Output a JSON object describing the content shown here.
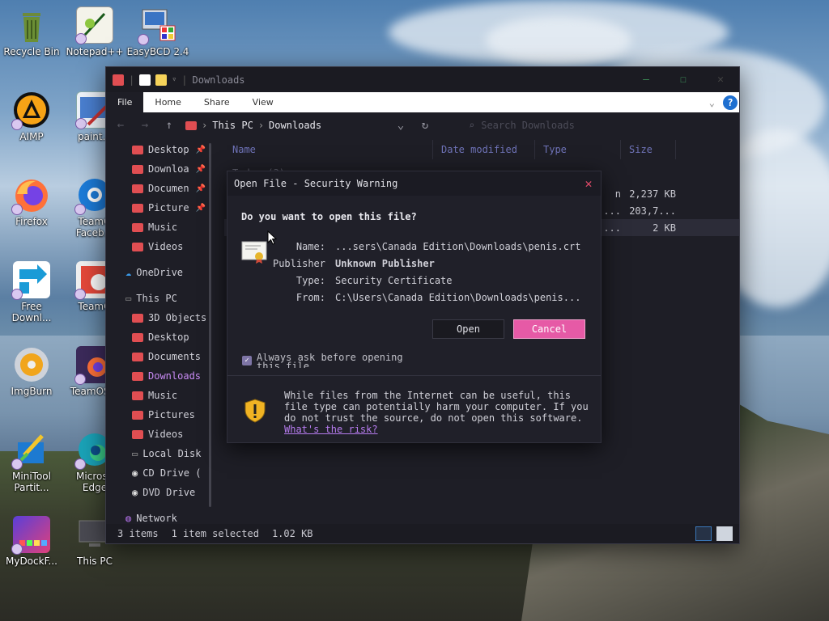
{
  "desktop": {
    "icons": [
      {
        "label": "Recycle Bin",
        "icon": "recycle-bin-icon"
      },
      {
        "label": "Notepad++",
        "icon": "notepad-plus-plus-icon"
      },
      {
        "label": "EasyBCD 2.4",
        "icon": "easybcd-icon"
      },
      {
        "label": "AIMP",
        "icon": "aimp-icon"
      },
      {
        "label": "paint.n",
        "icon": "paint-net-icon"
      },
      {
        "label": "Firefox",
        "icon": "firefox-icon"
      },
      {
        "label": "TeamO Faceb...",
        "icon": "teamos-facebook-icon"
      },
      {
        "label": "Free Downl...",
        "icon": "free-download-manager-icon"
      },
      {
        "label": "TeamO",
        "icon": "teamos-icon"
      },
      {
        "label": "ImgBurn",
        "icon": "imgburn-icon"
      },
      {
        "label": "TeamOS...",
        "icon": "teamos-firefox-icon"
      },
      {
        "label": "MiniTool Partit...",
        "icon": "minitool-partition-icon"
      },
      {
        "label": "Microso Edge",
        "icon": "microsoft-edge-icon"
      },
      {
        "label": "MyDockF...",
        "icon": "mydockfinder-icon"
      },
      {
        "label": "This PC",
        "icon": "this-pc-icon"
      }
    ]
  },
  "explorer": {
    "title": "Downloads",
    "window_buttons": {
      "minimize": "—",
      "maximize": "☐",
      "close": "✕"
    },
    "ribbon_tabs": [
      "File",
      "Home",
      "Share",
      "View"
    ],
    "help": "?",
    "address": {
      "root": "This PC",
      "current": "Downloads",
      "search_placeholder": "Search Downloads"
    },
    "nav": {
      "quick_access": [
        {
          "label": "Desktop",
          "pinned": true
        },
        {
          "label": "Downloa",
          "pinned": true
        },
        {
          "label": "Documen",
          "pinned": true
        },
        {
          "label": "Picture",
          "pinned": true
        },
        {
          "label": "Music",
          "pinned": false
        },
        {
          "label": "Videos",
          "pinned": false
        }
      ],
      "onedrive": "OneDrive",
      "this_pc": "This PC",
      "this_pc_items": [
        "3D Objects",
        "Desktop",
        "Documents",
        "Downloads",
        "Music",
        "Pictures",
        "Videos",
        "Local Disk",
        "CD Drive (",
        "DVD Drive"
      ],
      "network": "Network"
    },
    "columns": [
      "Name",
      "Date modified",
      "Type",
      "Size"
    ],
    "group": "Today (3)",
    "files": [
      {
        "type_frag": "n",
        "size": "2,237 KB"
      },
      {
        "type_frag": "...",
        "size": "203,7..."
      },
      {
        "type_frag": "...",
        "size": "2 KB"
      }
    ],
    "status": {
      "items": "3 items",
      "selected": "1 item selected",
      "size": "1.02 KB"
    }
  },
  "dialog": {
    "title": "Open File - Security Warning",
    "question": "Do you want to open this file?",
    "fields": [
      {
        "label": "Name:",
        "value": "...sers\\Canada Edition\\Downloads\\penis.crt",
        "bold": false
      },
      {
        "label": "Publisher:",
        "value": "Unknown Publisher",
        "bold": true
      },
      {
        "label": "Type:",
        "value": "Security Certificate",
        "bold": false
      },
      {
        "label": "From:",
        "value": "C:\\Users\\Canada Edition\\Downloads\\penis...",
        "bold": false
      }
    ],
    "open_label": "Open",
    "cancel_label": "Cancel",
    "checkbox_label": "Always ask before opening this file",
    "checkbox_checked": true,
    "warning_text": "While files from the Internet can be useful, this file type can potentially harm your computer. If you do not trust the source, do not open this software.",
    "risk_link": "What's the risk?"
  },
  "colors": {
    "accent": "#c98bf5",
    "cancel": "#e65aa6",
    "link": "#b77cf0",
    "folder": "#e04e52"
  }
}
